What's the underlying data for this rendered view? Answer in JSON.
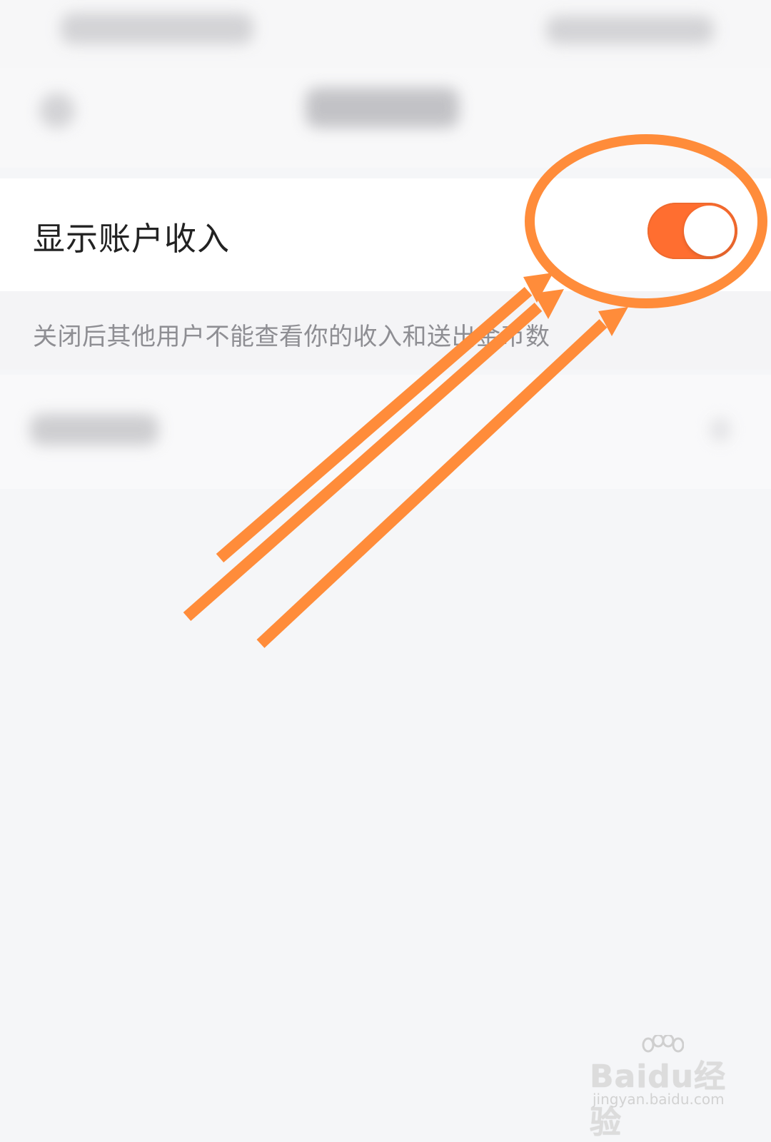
{
  "settings": {
    "show_income_label": "显示账户收入",
    "show_income_enabled": true,
    "description": "关闭后其他用户不能查看你的收入和送出金币数"
  },
  "watermark": {
    "brand": "Baidu经验",
    "url": "jingyan.baidu.com"
  },
  "colors": {
    "accent": "#ff6e30",
    "annotation": "#ff8c3a",
    "background": "#f5f6f8"
  }
}
